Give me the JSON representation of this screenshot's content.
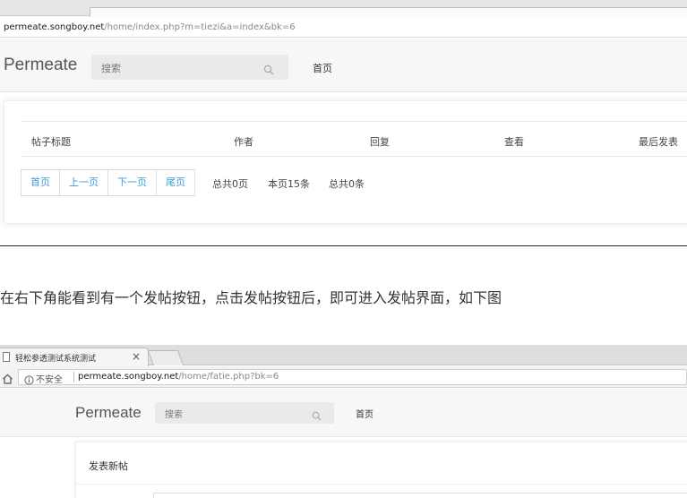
{
  "shot1": {
    "url_host": "permeate.songboy.net",
    "url_path": "/home/index.php?m=tiezi&a=index&bk=6",
    "brand": "Permeate",
    "search_placeholder": "搜索",
    "nav_home": "首页",
    "table_headers": [
      "帖子标题",
      "作者",
      "回复",
      "查看",
      "最后发表"
    ],
    "pager_buttons": [
      "首页",
      "上一页",
      "下一页",
      "尾页"
    ],
    "pager_info": [
      "总共0页",
      "本页15条",
      "总共0条"
    ]
  },
  "sentence": "在右下角能看到有一个发帖按钮，点击发帖按钮后，即可进入发帖界面，如下图",
  "shot2": {
    "tab_title": "轻松参透测试系统测试",
    "tab_close": "×",
    "insecure_label": "不安全",
    "url_host": "permeate.songboy.net",
    "url_path": "/home/fatie.php?bk=6",
    "brand": "Permeate",
    "search_placeholder": "搜索",
    "nav_home": "首页",
    "post_heading": "发表新帖"
  },
  "colors": {
    "pager_link": "#3d9cd3",
    "navbar_bg": "#f7f7f7"
  }
}
